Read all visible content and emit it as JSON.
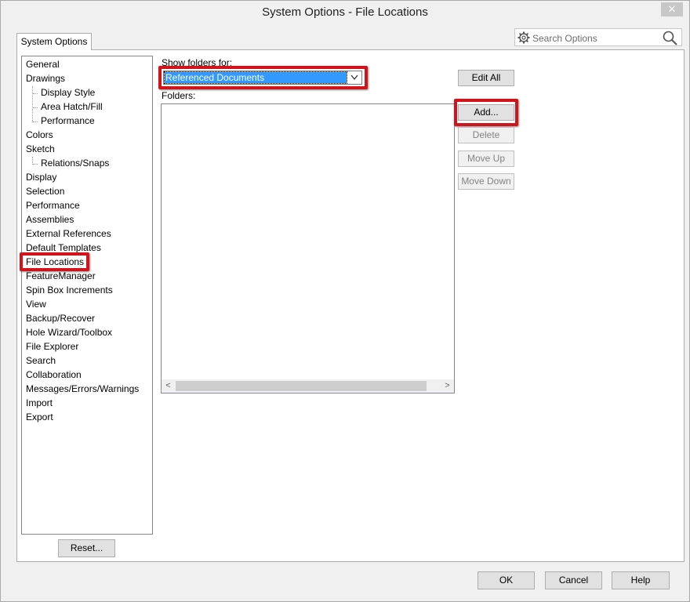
{
  "window": {
    "title": "System Options - File Locations",
    "close_glyph": "✕"
  },
  "tab": {
    "label": "System Options"
  },
  "search": {
    "placeholder": "Search Options"
  },
  "tree": {
    "items": [
      {
        "label": "General",
        "level": 0
      },
      {
        "label": "Drawings",
        "level": 0
      },
      {
        "label": "Display Style",
        "level": 1
      },
      {
        "label": "Area Hatch/Fill",
        "level": 1
      },
      {
        "label": "Performance",
        "level": 1
      },
      {
        "label": "Colors",
        "level": 0
      },
      {
        "label": "Sketch",
        "level": 0
      },
      {
        "label": "Relations/Snaps",
        "level": 1
      },
      {
        "label": "Display",
        "level": 0
      },
      {
        "label": "Selection",
        "level": 0
      },
      {
        "label": "Performance",
        "level": 0
      },
      {
        "label": "Assemblies",
        "level": 0
      },
      {
        "label": "External References",
        "level": 0
      },
      {
        "label": "Default Templates",
        "level": 0
      },
      {
        "label": "File Locations",
        "level": 0
      },
      {
        "label": "FeatureManager",
        "level": 0
      },
      {
        "label": "Spin Box Increments",
        "level": 0
      },
      {
        "label": "View",
        "level": 0
      },
      {
        "label": "Backup/Recover",
        "level": 0
      },
      {
        "label": "Hole Wizard/Toolbox",
        "level": 0
      },
      {
        "label": "File Explorer",
        "level": 0
      },
      {
        "label": "Search",
        "level": 0
      },
      {
        "label": "Collaboration",
        "level": 0
      },
      {
        "label": "Messages/Errors/Warnings",
        "level": 0
      },
      {
        "label": "Import",
        "level": 0
      },
      {
        "label": "Export",
        "level": 0
      }
    ],
    "selected": "File Locations"
  },
  "main": {
    "show_folders_label": "Show folders for:",
    "show_folders_value": "Referenced Documents",
    "folders_label": "Folders:",
    "scroll_left": "<",
    "scroll_right": ">"
  },
  "buttons": {
    "edit_all": "Edit All",
    "add": "Add...",
    "delete": "Delete",
    "move_up": "Move Up",
    "move_down": "Move Down",
    "reset": "Reset...",
    "ok": "OK",
    "cancel": "Cancel",
    "help": "Help"
  },
  "colors": {
    "highlight_red": "#d3131b",
    "selection_blue": "#3399ff"
  }
}
